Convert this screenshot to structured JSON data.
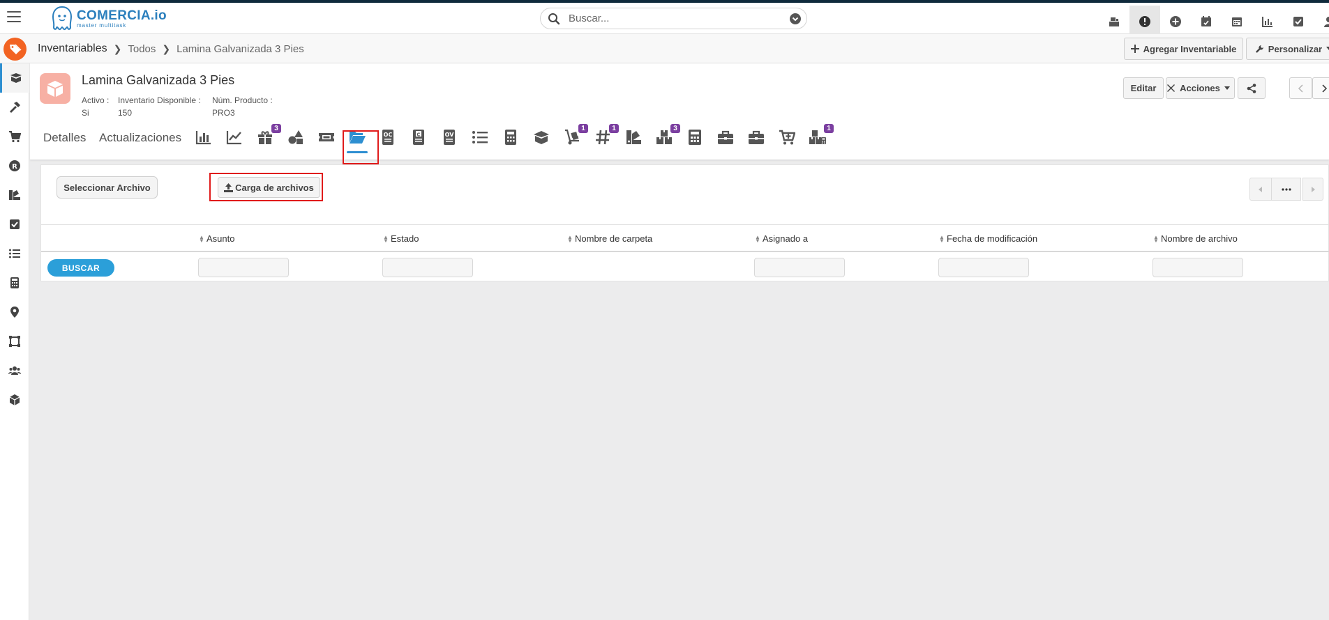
{
  "app": {
    "logo_name": "COMERCIA.io",
    "logo_tagline": "master multitask"
  },
  "search": {
    "placeholder": "Buscar..."
  },
  "breadcrumb": {
    "module": "Inventariables",
    "list": "Todos",
    "record": "Lamina Galvanizada 3 Pies"
  },
  "header_buttons": {
    "add": "Agregar Inventariable",
    "customize": "Personalizar"
  },
  "record": {
    "title": "Lamina Galvanizada 3 Pies",
    "fields": [
      {
        "label": "Activo :",
        "value": "Si"
      },
      {
        "label": "Inventario Disponible :",
        "value": "150"
      },
      {
        "label": "Núm. Producto :",
        "value": "PRO3"
      }
    ],
    "buttons": {
      "edit": "Editar",
      "actions": "Acciones"
    }
  },
  "tabs": {
    "details": "Detalles",
    "updates": "Actualizaciones",
    "badges": {
      "packages": "3",
      "cart_person": "1",
      "hash": "1",
      "boxes": "3",
      "boxes_calc": "1"
    }
  },
  "files": {
    "select_button": "Seleccionar Archivo",
    "upload_button": "Carga de archivos",
    "search_button": "BUSCAR",
    "columns": [
      "Asunto",
      "Estado",
      "Nombre de carpeta",
      "Asignado a",
      "Fecha de modificación",
      "Nombre de archivo"
    ]
  },
  "colors": {
    "accent": "#2e8fd1",
    "brand": "#f26322",
    "badge": "#7b3fa0",
    "highlight": "#e01b1b"
  }
}
